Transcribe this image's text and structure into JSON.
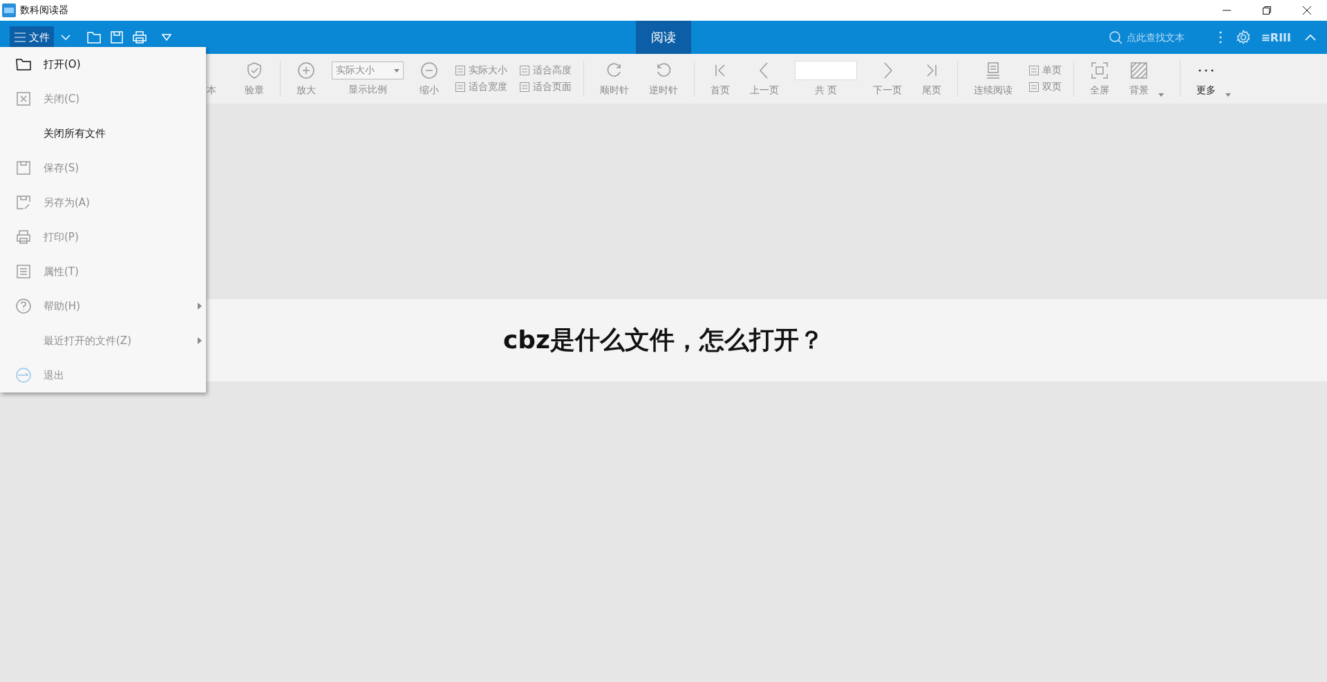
{
  "window": {
    "title": "数科阅读器"
  },
  "topbar": {
    "file_menu": {
      "label": "文件",
      "selected": true
    },
    "tabs": [
      {
        "label": "阅读",
        "selected": true
      }
    ],
    "search": {
      "placeholder": "点此查找文本"
    },
    "badge": "≡RIII"
  },
  "toolbar": [
    {
      "kind": "partial",
      "label": "本",
      "disabled": true
    },
    {
      "kind": "big",
      "label": "验章",
      "disabled": true
    },
    {
      "kind": "sep"
    },
    {
      "kind": "big",
      "label": "放大",
      "disabled": true
    },
    {
      "kind": "select",
      "value": "实际大小",
      "label": "显示比例",
      "disabled": true
    },
    {
      "kind": "big",
      "label": "缩小",
      "disabled": true
    },
    {
      "kind": "pair",
      "items": [
        "实际大小",
        "适合宽度"
      ],
      "disabled": true
    },
    {
      "kind": "pair",
      "items": [
        "适合高度",
        "适合页面"
      ],
      "disabled": true
    },
    {
      "kind": "sep"
    },
    {
      "kind": "big",
      "label": "顺时针",
      "disabled": true
    },
    {
      "kind": "big",
      "label": "逆时针",
      "disabled": true
    },
    {
      "kind": "sep"
    },
    {
      "kind": "big",
      "label": "首页",
      "disabled": true
    },
    {
      "kind": "big",
      "label": "上一页",
      "disabled": true
    },
    {
      "kind": "page",
      "label": "共 页",
      "disabled": true
    },
    {
      "kind": "big",
      "label": "下一页",
      "disabled": true
    },
    {
      "kind": "big",
      "label": "尾页",
      "disabled": true
    },
    {
      "kind": "sep"
    },
    {
      "kind": "big",
      "label": "连续阅读",
      "disabled": true
    },
    {
      "kind": "pair",
      "items": [
        "单页",
        "双页"
      ],
      "disabled": true
    },
    {
      "kind": "sep"
    },
    {
      "kind": "big",
      "label": "全屏",
      "disabled": true
    },
    {
      "kind": "drop",
      "label": "背景",
      "disabled": true
    },
    {
      "kind": "sep"
    },
    {
      "kind": "drop",
      "label": "更多",
      "disabled": false
    }
  ],
  "file_menu": [
    {
      "label": "打开(O)",
      "disabled": false,
      "submenu": false
    },
    {
      "label": "关闭(C)",
      "disabled": true,
      "submenu": false
    },
    {
      "label": "关闭所有文件",
      "disabled": false,
      "submenu": false
    },
    {
      "label": "保存(S)",
      "disabled": true,
      "submenu": false
    },
    {
      "label": "另存为(A)",
      "disabled": true,
      "submenu": false
    },
    {
      "label": "打印(P)",
      "disabled": true,
      "submenu": false
    },
    {
      "label": "属性(T)",
      "disabled": true,
      "submenu": false
    },
    {
      "label": "帮助(H)",
      "disabled": true,
      "submenu": true
    },
    {
      "label": "最近打开的文件(Z)",
      "disabled": true,
      "submenu": true
    },
    {
      "label": "退出",
      "disabled": true,
      "submenu": false
    }
  ],
  "banner": {
    "title": "cbz是什么文件，怎么打开？"
  }
}
